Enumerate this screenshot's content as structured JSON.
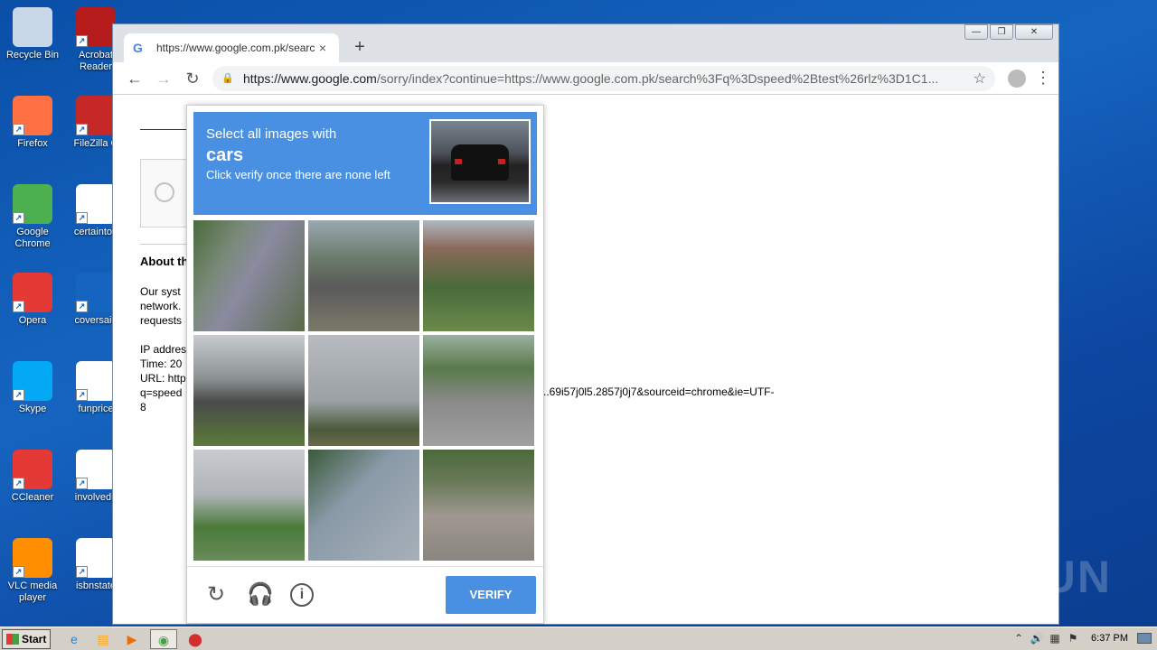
{
  "desktop": {
    "icons": [
      {
        "label": "Recycle Bin",
        "icon": "recycle-bin-icon",
        "color": "#c8d8e8"
      },
      {
        "label": "Acrobat Reader",
        "icon": "acrobat-icon",
        "color": "#b71c1c"
      },
      {
        "label": "Firefox",
        "icon": "firefox-icon",
        "color": "#ff7043"
      },
      {
        "label": "FileZilla C",
        "icon": "filezilla-icon",
        "color": "#c62828"
      },
      {
        "label": "Google Chrome",
        "icon": "chrome-icon",
        "color": "#4caf50"
      },
      {
        "label": "certaintoo",
        "icon": "word-doc-icon",
        "color": "#ffffff"
      },
      {
        "label": "Opera",
        "icon": "opera-icon",
        "color": "#e53935"
      },
      {
        "label": "coversaid",
        "icon": "blank-doc-icon",
        "color": "#1565c0"
      },
      {
        "label": "Skype",
        "icon": "skype-icon",
        "color": "#03a9f4"
      },
      {
        "label": "funprice",
        "icon": "word-doc-icon",
        "color": "#ffffff"
      },
      {
        "label": "CCleaner",
        "icon": "ccleaner-icon",
        "color": "#e53935"
      },
      {
        "label": "involvedn",
        "icon": "word-doc-icon",
        "color": "#ffffff"
      },
      {
        "label": "VLC media player",
        "icon": "vlc-icon",
        "color": "#ff8f00"
      },
      {
        "label": "isbnstate",
        "icon": "word-doc-icon",
        "color": "#ffffff"
      }
    ]
  },
  "browser": {
    "tab_title": "https://www.google.com.pk/search?",
    "tab_close": "×",
    "new_tab": "+",
    "win_min": "—",
    "win_max": "❐",
    "win_close": "✕",
    "back": "←",
    "forward": "→",
    "reload": "↻",
    "url_host": "https://www.google.com",
    "url_rest": "/sorry/index?continue=https://www.google.com.pk/search%3Fq%3Dspeed%2Btest%26rlz%3D1C1...",
    "star": "☆",
    "menu": "⋮"
  },
  "page": {
    "about": "About th",
    "line1": "Our syst",
    "line2": "network.",
    "line3": "requests",
    "ip": "IP addres",
    "time": "Time: 20",
    "url": "URL: http",
    "q": "q=speed",
    "eight": "8",
    "url_tail": "..69i57j0l5.2857j0j7&sourceid=chrome&ie=UTF-"
  },
  "captcha": {
    "line1": "Select all images with",
    "target": "cars",
    "line3": "Click verify once there are none left",
    "verify": "VERIFY",
    "reload_icon": "↻",
    "audio_icon": "🎧",
    "info_icon": "i",
    "accent": "#4a90e2"
  },
  "watermark": "ANY ▷ RUN",
  "taskbar": {
    "start": "Start",
    "clock": "6:37 PM"
  }
}
